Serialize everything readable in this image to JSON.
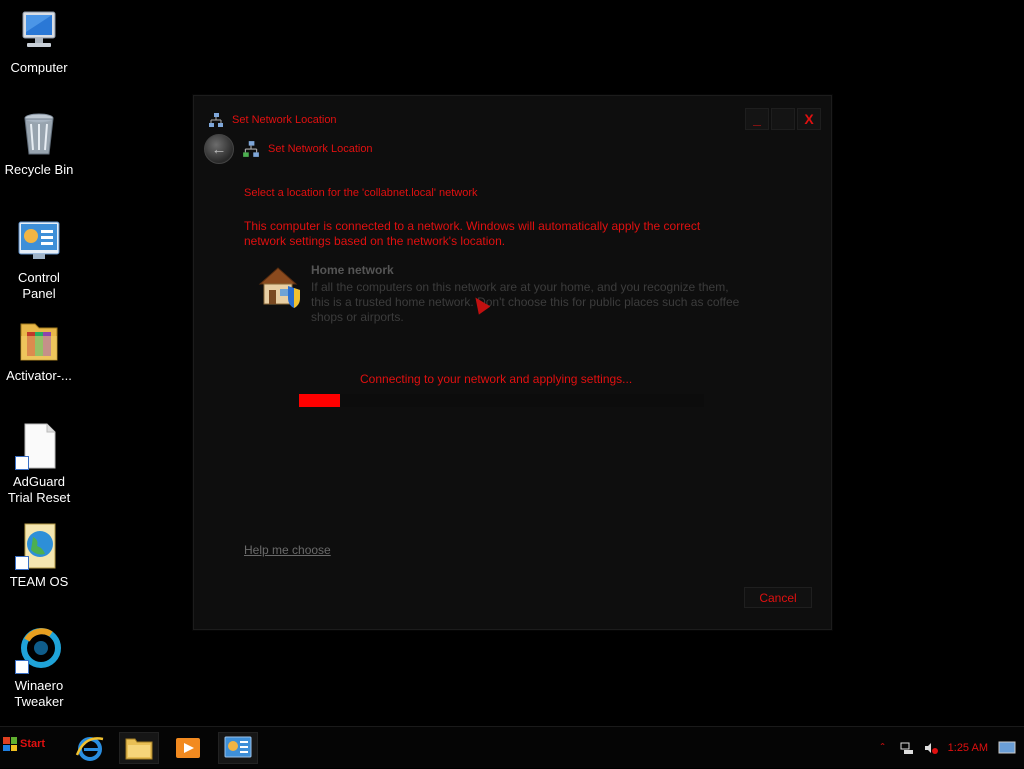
{
  "desktop": {
    "icons": [
      {
        "name": "Computer",
        "icon": "computer-icon"
      },
      {
        "name": "Recycle Bin",
        "icon": "recycle-bin-icon"
      },
      {
        "name": "Control\nPanel",
        "icon": "control-panel-icon"
      },
      {
        "name": "Activator-...",
        "icon": "folder-icon"
      },
      {
        "name": "AdGuard\nTrial Reset",
        "icon": "file-shortcut-icon"
      },
      {
        "name": "TEAM OS",
        "icon": "globe-shortcut-icon"
      },
      {
        "name": "Winaero\nTweaker",
        "icon": "tweaker-shortcut-icon"
      }
    ]
  },
  "dialog": {
    "window_title": "Set Network Location",
    "breadcrumb": "Set Network Location",
    "heading": "Select a location for the 'collabnet.local' network",
    "description": "This computer is connected to a network. Windows will automatically apply the correct network settings based on the network's location.",
    "option": {
      "title": "Home network",
      "description": "If all the computers on this network are at your home, and you recognize them, this is a trusted home network. Don't choose this for public places such as coffee shops or airports."
    },
    "status": "Connecting to your network and applying settings...",
    "progress": 0.1,
    "help_link": "Help me choose",
    "cancel_label": "Cancel",
    "minimize_glyph": "_",
    "close_glyph": "X"
  },
  "taskbar": {
    "start_label": "Start",
    "apps": [
      "internet-explorer-icon",
      "file-explorer-icon",
      "media-player-icon",
      "control-panel-icon"
    ],
    "clock": "1:25 AM"
  },
  "colors": {
    "accent": "#e01010",
    "background": "#000000",
    "dialog_bg": "#0e0e0e"
  }
}
